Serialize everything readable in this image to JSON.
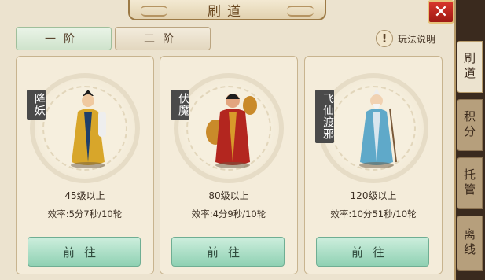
{
  "title": "刷道",
  "close_icon": "close-x-icon",
  "tier_tabs": [
    {
      "label": "一阶",
      "active": true
    },
    {
      "label": "二阶",
      "active": false
    }
  ],
  "help": {
    "icon": "question-icon",
    "label": "玩法说明"
  },
  "cards": [
    {
      "vertical_label": "降妖",
      "level": "45级以上",
      "efficiency": "效率:5分7秒/10轮",
      "button": "前往",
      "robe_color": "#d8a62a",
      "trim_color": "#1f3f6a"
    },
    {
      "vertical_label": "伏魔",
      "level": "80级以上",
      "efficiency": "效率:4分9秒/10轮",
      "button": "前往",
      "robe_color": "#b3261f",
      "trim_color": "#d89a2a"
    },
    {
      "vertical_label": "飞仙渡邪",
      "level": "120级以上",
      "efficiency": "效率:10分51秒/10轮",
      "button": "前往",
      "robe_color": "#5fa9c9",
      "trim_color": "#d9e6ee"
    }
  ],
  "side_tabs": [
    {
      "label": "刷道",
      "active": true
    },
    {
      "label": "积分",
      "active": false
    },
    {
      "label": "托管",
      "active": false
    },
    {
      "label": "离线",
      "active": false
    }
  ]
}
